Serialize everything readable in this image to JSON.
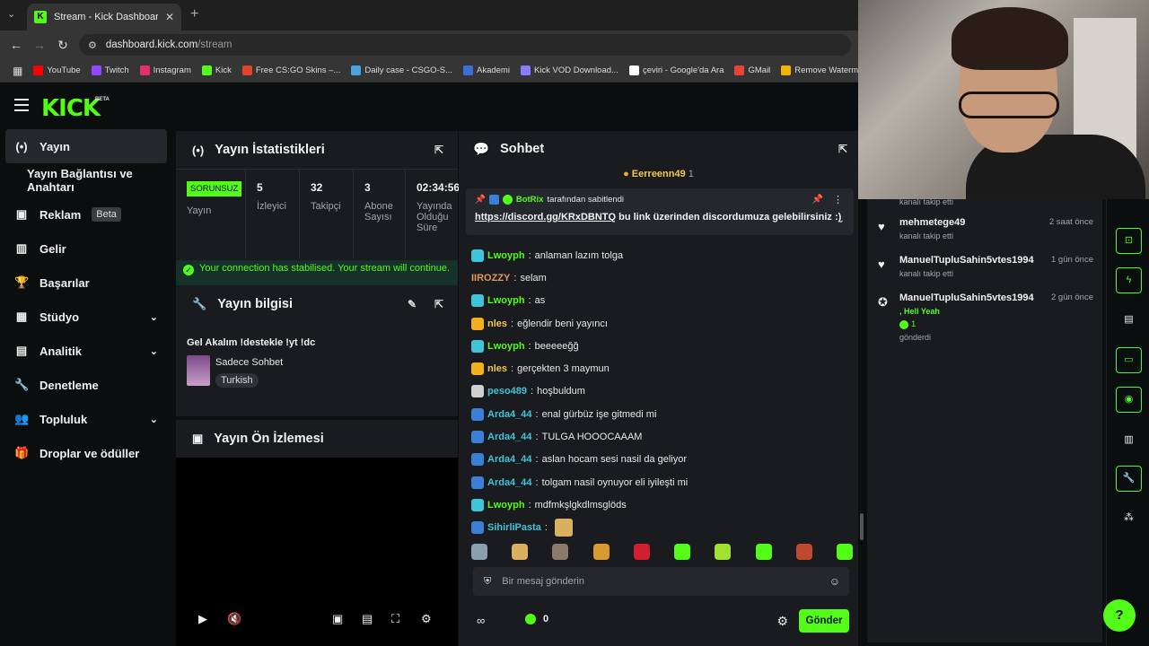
{
  "browser": {
    "tab_title": "Stream - Kick Dashboard",
    "url_host": "dashboard.kick.com",
    "url_path": "/stream",
    "bookmarks": [
      {
        "label": "YouTube",
        "color": "#ff0000"
      },
      {
        "label": "Twitch",
        "color": "#9146ff"
      },
      {
        "label": "Instagram",
        "color": "#e1306c"
      },
      {
        "label": "Kick",
        "color": "#53fc18"
      },
      {
        "label": "Free CS:GO Skins –...",
        "color": "#e0442a"
      },
      {
        "label": "Daily case - CSGO-S...",
        "color": "#4aa3df"
      },
      {
        "label": "Akademi",
        "color": "#3b6fd6"
      },
      {
        "label": "Kick VOD Download...",
        "color": "#8a7cff"
      },
      {
        "label": "çeviri - Google'da Ara",
        "color": "#ffffff"
      },
      {
        "label": "GMail",
        "color": "#ea4335"
      },
      {
        "label": "Remove Watermark...",
        "color": "#f4b400"
      }
    ]
  },
  "app": {
    "logo": "KICK",
    "logo_beta": "BETA",
    "sidebar": [
      {
        "label": "Yayın",
        "icon": "broadcast-icon",
        "glyph": "(•)",
        "active": true
      },
      {
        "label": "Yayın Bağlantısı ve Anahtarı",
        "icon": "",
        "glyph": ""
      },
      {
        "label": "Reklam",
        "icon": "ad-icon",
        "glyph": "▣",
        "badge": "Beta"
      },
      {
        "label": "Gelir",
        "icon": "revenue-icon",
        "glyph": "▥"
      },
      {
        "label": "Başarılar",
        "icon": "trophy-icon",
        "glyph": "🏆"
      },
      {
        "label": "Stüdyo",
        "icon": "studio-icon",
        "glyph": "▦",
        "chevron": true
      },
      {
        "label": "Analitik",
        "icon": "analytics-icon",
        "glyph": "▤",
        "chevron": true
      },
      {
        "label": "Denetleme",
        "icon": "wrench-icon",
        "glyph": "🔧"
      },
      {
        "label": "Topluluk",
        "icon": "community-icon",
        "glyph": "👥",
        "chevron": true
      },
      {
        "label": "Droplar ve ödüller",
        "icon": "drops-icon",
        "glyph": "🎁"
      }
    ],
    "stats_panel": {
      "title": "Yayın İstatistikleri",
      "status_badge": "SORUNSUZ",
      "status_label": "Yayın",
      "stats": [
        {
          "value": "5",
          "label": "İzleyici"
        },
        {
          "value": "32",
          "label": "Takipçi"
        },
        {
          "value": "3",
          "label": "Abone Sayısı"
        },
        {
          "value": "02:34:56",
          "label": "Yayında Olduğu Süre"
        }
      ],
      "notice": "Your connection has stabilised. Your stream will continue."
    },
    "info_panel": {
      "title": "Yayın bilgisi",
      "stream_title": "Gel Akalım !destekle !yt !dc",
      "category": "Sadece Sohbet",
      "language": "Turkish"
    },
    "preview_panel": {
      "title": "Yayın Ön İzlemesi"
    },
    "chat": {
      "title": "Sohbet",
      "leader_name": "Eerreenn49",
      "leader_count": "1",
      "pinned_by_user": "BotRix",
      "pinned_by_text": "tarafından sabitlendi",
      "pinned_link": "https://discord.gg/KRxDBNTQ",
      "pinned_text": "bu link üzerinden discordumuza gelebilirsiniz :)",
      "messages": [
        {
          "user": "Lwoyph",
          "color": "#53fc18",
          "badge": "#40c4d8",
          "text": "anlaman lazım tolga"
        },
        {
          "user": "IIROZZY",
          "color": "#e09a5a",
          "badge": "",
          "text": "selam"
        },
        {
          "user": "Lwoyph",
          "color": "#53fc18",
          "badge": "#40c4d8",
          "text": "as"
        },
        {
          "user": "nles",
          "color": "#f2c94c",
          "badge": "#f2b01e",
          "text": "eğlendir beni yayıncı"
        },
        {
          "user": "Lwoyph",
          "color": "#53fc18",
          "badge": "#40c4d8",
          "text": "beeeeeğğ"
        },
        {
          "user": "nles",
          "color": "#f2c94c",
          "badge": "#f2b01e",
          "text": "gerçekten 3 maymun"
        },
        {
          "user": "peso489",
          "color": "#40c4d8",
          "badge": "#d0d0d0",
          "text": "hoşbuldum"
        },
        {
          "user": "Arda4_44",
          "color": "#40c4d8",
          "badge": "#3b7fd6",
          "text": "enal gürbüz işe gitmedi mi"
        },
        {
          "user": "Arda4_44",
          "color": "#40c4d8",
          "badge": "#3b7fd6",
          "text": "TULGA HOOOCAAAM"
        },
        {
          "user": "Arda4_44",
          "color": "#40c4d8",
          "badge": "#3b7fd6",
          "text": "aslan hocam sesi nasil da geliyor"
        },
        {
          "user": "Arda4_44",
          "color": "#40c4d8",
          "badge": "#3b7fd6",
          "text": "tolgam nasil oynuyor eli iyileşti mi"
        },
        {
          "user": "Lwoyph",
          "color": "#53fc18",
          "badge": "#40c4d8",
          "text": "mdfmkşlgkdlmsglöds"
        },
        {
          "user": "SihirliPasta",
          "color": "#40c4d8",
          "badge": "#3b7fd6",
          "text": ""
        }
      ],
      "emotes": [
        "#8aa0b0",
        "#d8b060",
        "#8a7a6a",
        "#d89a30",
        "#d02030",
        "#53fc18",
        "#a0e030",
        "#53fc18",
        "#c04a30",
        "#53fc18"
      ],
      "input_placeholder": "Bir mesaj gönderin",
      "points": "0",
      "send_label": "Gönder"
    }
  },
  "alerts": [
    {
      "name": "",
      "time": "",
      "sub": "kanalı takip etti"
    },
    {
      "name": "mehmetege49",
      "time": "2 saat önce",
      "sub": "kanalı takip etti"
    },
    {
      "name": "ManuelTupluSahin5vtes1994",
      "time": "1 gün önce",
      "sub": "kanalı takip etti"
    },
    {
      "name": "ManuelTupluSahin5vtes1994",
      "time": "2 gün önce",
      "green": ", Hell Yeah",
      "gift_count": "1",
      "gift_text": "gönderdi"
    }
  ],
  "colors": {
    "accent": "#53fc18",
    "bg": "#0b0e0f",
    "panel": "#191b1f"
  }
}
